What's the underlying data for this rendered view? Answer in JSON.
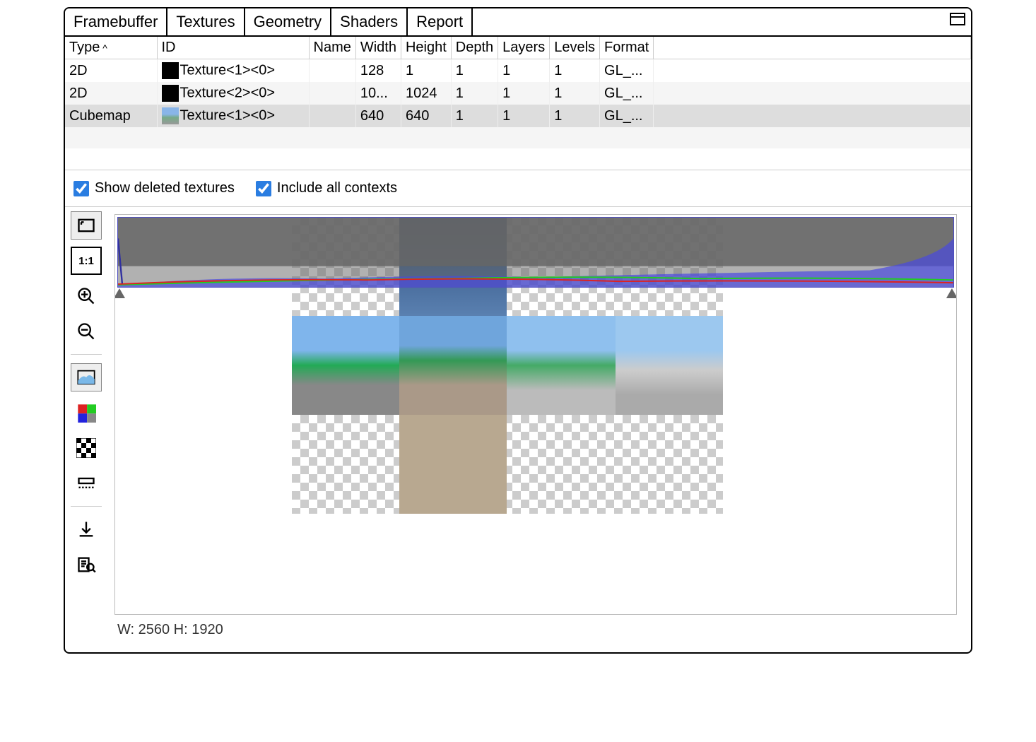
{
  "tabs": [
    "Framebuffer",
    "Textures",
    "Geometry",
    "Shaders",
    "Report"
  ],
  "active_tab": 1,
  "columns": [
    "Type",
    "ID",
    "Name",
    "Width",
    "Height",
    "Depth",
    "Layers",
    "Levels",
    "Format"
  ],
  "rows": [
    {
      "type": "2D",
      "id": "Texture<1><0>",
      "name": "",
      "width": "128",
      "height": "1",
      "depth": "1",
      "layers": "1",
      "levels": "1",
      "format": "GL_...",
      "thumb": "black"
    },
    {
      "type": "2D",
      "id": "Texture<2><0>",
      "name": "",
      "width": "10...",
      "height": "1024",
      "depth": "1",
      "layers": "1",
      "levels": "1",
      "format": "GL_...",
      "thumb": "black"
    },
    {
      "type": "Cubemap",
      "id": "Texture<1><0>",
      "name": "",
      "width": "640",
      "height": "640",
      "depth": "1",
      "layers": "1",
      "levels": "1",
      "format": "GL_...",
      "thumb": "img"
    }
  ],
  "selected_row": 2,
  "options": {
    "show_deleted": {
      "label": "Show deleted textures",
      "checked": true
    },
    "include_all": {
      "label": "Include all contexts",
      "checked": true
    }
  },
  "status": "W: 2560 H: 1920",
  "toolbar": {
    "fit": "fit-icon",
    "actual": "1:1",
    "zoom_in": "zoom-in-icon",
    "zoom_out": "zoom-out-icon",
    "histogram": "histogram-icon",
    "channels": "channels-icon",
    "checker": "checkerboard-icon",
    "flip": "flip-icon",
    "save": "download-icon",
    "inspect": "inspect-icon"
  }
}
